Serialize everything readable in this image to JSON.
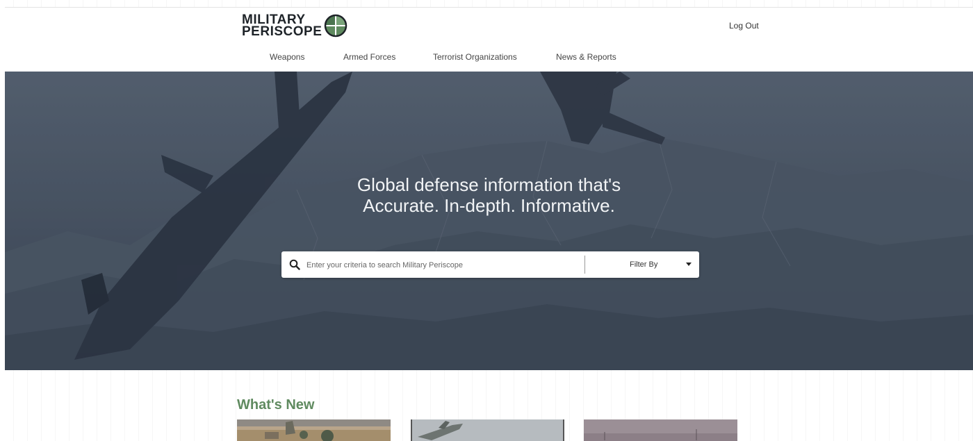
{
  "header": {
    "logo_line1": "MILITARY",
    "logo_line2": "PERISCOPE",
    "logout_label": "Log Out"
  },
  "nav": {
    "items": [
      {
        "label": "Weapons"
      },
      {
        "label": "Armed Forces"
      },
      {
        "label": "Terrorist Organizations"
      },
      {
        "label": "News & Reports"
      }
    ]
  },
  "hero": {
    "title_line1": "Global defense information that's",
    "title_line2": "Accurate. In-depth. Informative."
  },
  "search": {
    "placeholder": "Enter your criteria to search Military Periscope",
    "value": "",
    "filter_label": "Filter By"
  },
  "whats_new": {
    "heading": "What's New"
  },
  "icons": {
    "search": "search-icon",
    "logo": "periscope-globe-icon",
    "caret": "caret-down-icon"
  },
  "colors": {
    "brand_green": "#5f8a5f",
    "hero_overlay": "#44505d",
    "logo_dark": "#1e2328"
  }
}
